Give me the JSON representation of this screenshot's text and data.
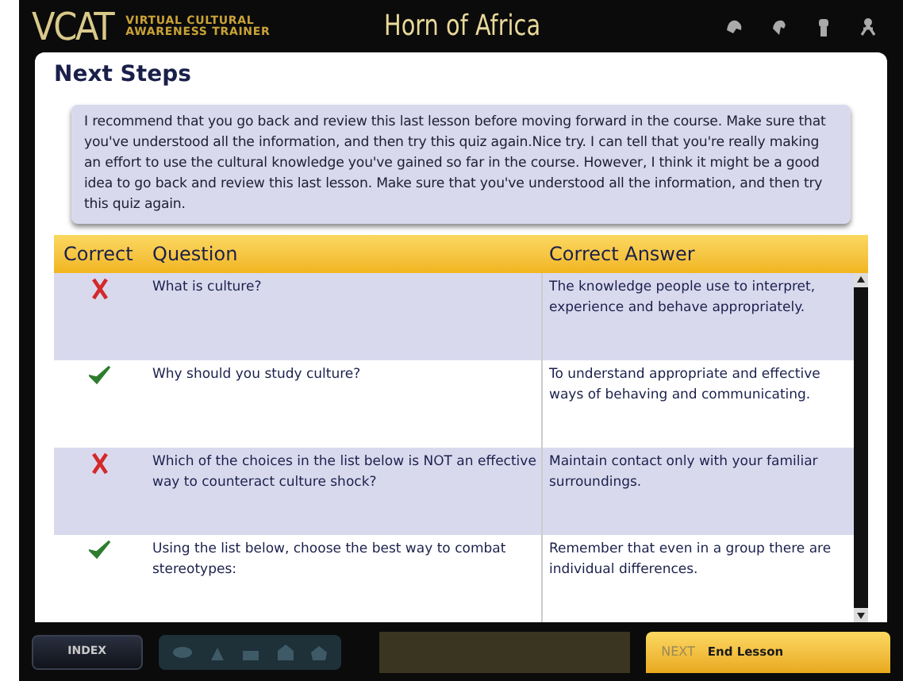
{
  "header": {
    "logo": "VCAT",
    "subtitle_1": "VIRTUAL CULTURAL",
    "subtitle_2": "AWARENESS TRAINER",
    "title": "Horn of Africa"
  },
  "section_title": "Next Steps",
  "feedback": "I recommend that you go back and review this last lesson before moving forward in the course. Make sure that you've understood all the information, and then try this quiz again.Nice try. I can tell that you're really making an effort to use the cultural knowledge you've gained so far in the course. However, I think it might be a good idea to go back and review this last lesson. Make sure that you've understood all the information, and then try this quiz again.",
  "table": {
    "columns": [
      "Correct",
      "Question",
      "Correct Answer"
    ],
    "rows": [
      {
        "correct": false,
        "question": "What is culture?",
        "answer": "The knowledge people use to interpret, experience and behave appropriately."
      },
      {
        "correct": true,
        "question": "Why should you study culture?",
        "answer": "To understand appropriate and effective ways of behaving and communicating."
      },
      {
        "correct": false,
        "question": "Which of the choices in the list below is NOT an effective way to counteract culture shock?",
        "answer": "Maintain contact only with your familiar surroundings."
      },
      {
        "correct": true,
        "question": "Using the list below, choose the best way to combat stereotypes:",
        "answer": "Remember that even in a group there are individual differences."
      }
    ]
  },
  "footer": {
    "index": "INDEX",
    "next_label": "NEXT",
    "next_action": "End Lesson"
  }
}
